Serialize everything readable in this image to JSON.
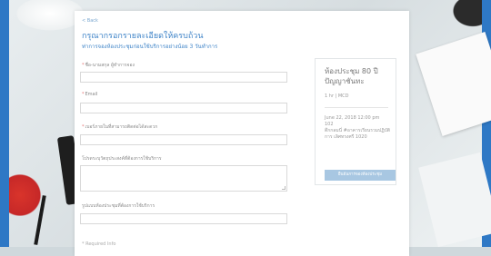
{
  "nav": {
    "back_label": "< Back"
  },
  "form": {
    "title": "กรุณากรอกรายละเอียดให้ครบถ้วน",
    "subtitle": "ท่าการจองห้องประชุมก่อนใช้บริการอย่างน้อย 3 วันทำการ",
    "fields": [
      {
        "label": "ชื่อ-นามสกุล ผู้ทำการจอง",
        "required": true,
        "value": ""
      },
      {
        "label": "Email",
        "required": true,
        "value": ""
      },
      {
        "label": "เบอร์ภายในที่สามารถติดต่อได้สะดวก",
        "required": true,
        "value": ""
      },
      {
        "label": "โปรดระบุวัตถุประสงค์ที่ต้องการใช้บริการ",
        "required": false,
        "value": ""
      },
      {
        "label": "รูปแบบห้องประชุมที่ต้องการใช้บริการ",
        "required": false,
        "value": ""
      }
    ],
    "footnote": "* Required Info"
  },
  "booking": {
    "room_title": "ห้องประชุม 80 ปี ปัญญาชันทะ",
    "meta": "1 hr  |  MCD",
    "datetime": "June 22, 2018 12:00 pm",
    "datetime_line2": "102",
    "location": "ตึกกลมนี่ #อาคารเรียนรวมปฏิบัติการ เลิศทรงศรี 1020",
    "confirm_label": "ยืนยันการจองห้องประชุม"
  }
}
